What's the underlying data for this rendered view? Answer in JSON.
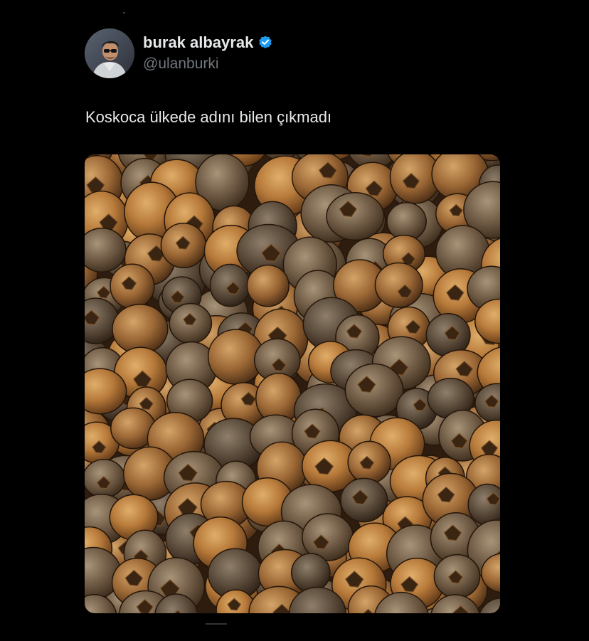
{
  "tweet": {
    "author": {
      "display_name": "burak albayrak",
      "handle": "@ulanburki",
      "verified": true,
      "avatar_icon": "user-avatar-photo"
    },
    "text": "Koskoca ülkede adını bilen çıkmadı",
    "media": {
      "kind": "photo",
      "subject": "pile of medlar fruits"
    }
  },
  "colors": {
    "background": "#000000",
    "primary_text": "#e7e9ea",
    "secondary_text": "#71767b",
    "verified_blue": "#1d9bf0",
    "fruit_dark": "#5a3a1e",
    "fruit_light": "#b8864a"
  },
  "icons": {
    "verified": "verified-badge-icon"
  }
}
